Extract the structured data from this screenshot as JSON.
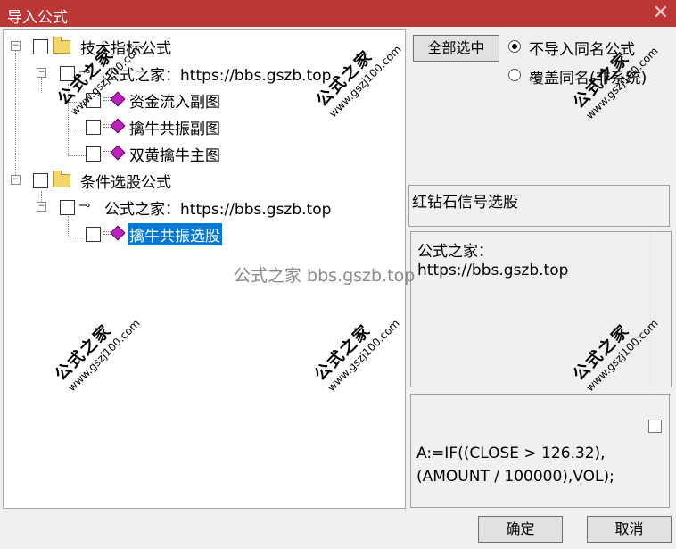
{
  "window": {
    "title": "导入公式",
    "close_symbol": "✕"
  },
  "tree": {
    "node1": {
      "label": "技术指标公式",
      "expander": "−"
    },
    "node1_child": {
      "label": "公式之家：https://bbs.gszb.top",
      "expander": "−"
    },
    "node1_items": [
      "资金流入副图",
      "擒牛共振副图",
      "双黄擒牛主图"
    ],
    "node2": {
      "label": "条件选股公式",
      "expander": "−"
    },
    "node2_child": {
      "label": "公式之家：https://bbs.gszb.top",
      "expander": "−"
    },
    "node2_items": [
      "擒牛共振选股"
    ]
  },
  "controls": {
    "select_all": "全部选中",
    "radio_skip": "不导入同名公式",
    "radio_overwrite": "覆盖同名(非系统)"
  },
  "detail": {
    "name": "红钻石信号选股",
    "desc_line1": "公式之家：",
    "desc_line2": "https://bbs.gszb.top",
    "code_line1": "A:=IF((CLOSE > 126.32),",
    "code_line2": "(AMOUNT / 100000),VOL);"
  },
  "footer": {
    "ok": "确定",
    "cancel": "取消"
  },
  "watermark": {
    "big": "公式之家",
    "small": "www.gszj100.com",
    "center": "公式之家 bbs.gszb.top"
  }
}
